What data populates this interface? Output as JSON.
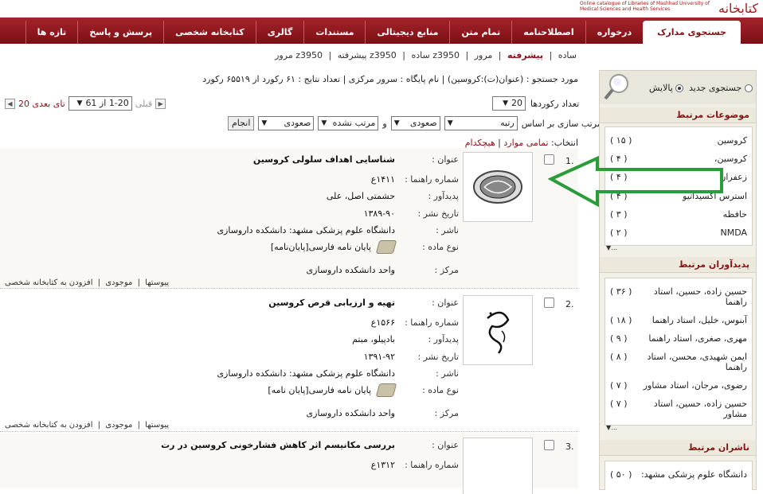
{
  "header": {
    "logo_text": "Online catalogue of Libraries of Mashhad University of Medical Sciences and Health Services",
    "logo_mark": "كتابخانه"
  },
  "nav": [
    {
      "label": "جستجوی مدارک",
      "active": true
    },
    {
      "label": "درخواره"
    },
    {
      "label": "اصطلاحنامه"
    },
    {
      "label": "تمام متن"
    },
    {
      "label": "منابع دیجیتالی"
    },
    {
      "label": "مستندات"
    },
    {
      "label": "گالری"
    },
    {
      "label": "کتابخانه شخصی"
    },
    {
      "label": "پرسش و پاسخ"
    },
    {
      "label": "تازه ها"
    }
  ],
  "breadcrumb": [
    "ساده",
    "|",
    "پیشرفته",
    "|",
    "مرور",
    "|",
    "z3950 ساده",
    "|",
    "z3950 پیشرفته",
    "|",
    "z3950 مرور"
  ],
  "summary": "مورد جستجو : (عنوان(ت):کروسین)  |  نام پایگاه : سرور مرکزی  |  تعداد نتایج : ۶۱ رکورد از ۶۵۵۱۹ رکورد",
  "pager": {
    "next_label": "20 تای بعدی",
    "range_value": "1-20 از 61",
    "prev_label": "قبلی"
  },
  "records": {
    "label": "تعداد رکوردها",
    "value": "20"
  },
  "sort": {
    "label": "مرتب سازی بر اساس",
    "field1": "رتبه",
    "order1": "صعودی",
    "and_label": "و",
    "field2": "مرتب نشده",
    "order2": "صعودی",
    "go": "انجام"
  },
  "select_bar": {
    "label": "انتخاب:",
    "all": "تمامی موارد",
    "sep": "|",
    "none": "هیچکدام"
  },
  "results": [
    {
      "num": "1.",
      "fields": [
        {
          "label": "عنوان :",
          "value": "شناسایی اهداف سلولی کروسین",
          "title": true
        },
        {
          "label": "شماره راهنما :",
          "value": "۱۴۱۱ع"
        },
        {
          "label": "پدیدآور :",
          "value": "حشمتی اصل، علی"
        },
        {
          "label": "تاریخ نشر :",
          "value": "۱۳۸۹-۹۰"
        },
        {
          "label": "ناشر :",
          "value": "دانشگاه علوم پزشکی مشهد: دانشکده داروسازی"
        },
        {
          "label": "نوع ماده :",
          "value": "پایان نامه فارسی[پایان‌نامه]"
        },
        {
          "label": "مرکز :",
          "value": "واحد دانشکده داروسازی"
        }
      ],
      "links": [
        "افزودن به کتابخانه شخصی",
        "|",
        "موجودی",
        "|",
        "پیوستها"
      ]
    },
    {
      "num": "2.",
      "fields": [
        {
          "label": "عنوان :",
          "value": "تهیه و ارزیابی قرص کروسین",
          "title": true
        },
        {
          "label": "شماره راهنما :",
          "value": "۱۵۶۶ع"
        },
        {
          "label": "پدیدآور :",
          "value": "بادپیلو، مبتم"
        },
        {
          "label": "تاریخ نشر :",
          "value": "۱۳۹۱-۹۲"
        },
        {
          "label": "ناشر :",
          "value": "دانشگاه علوم پزشکی مشهد: دانشکده داروسازی"
        },
        {
          "label": "نوع ماده :",
          "value": "پایان نامه فارسی[پایان نامه]"
        },
        {
          "label": "مرکز :",
          "value": "واحد دانشکده داروسازی"
        }
      ],
      "links": [
        "افزودن به کتابخانه شخصی",
        "|",
        "موجودی",
        "|",
        "پیوستها"
      ]
    },
    {
      "num": "3.",
      "fields": [
        {
          "label": "عنوان :",
          "value": "بررسی مکانیسم اثر کاهش فشارخونی کروسین در رت",
          "title": true
        },
        {
          "label": "شماره راهنما :",
          "value": "۱۳۱۲ع"
        }
      ]
    }
  ],
  "sidebar": {
    "new_search": "جستجوی جدید",
    "refine": "پالایش",
    "topics_title": "موضوعات مرتبط",
    "topics": [
      {
        "label": "کروسین",
        "count": "( ۱۵ )"
      },
      {
        "label": "کروسین،",
        "count": "( ۴ )"
      },
      {
        "label": "زعفران",
        "count": "( ۴ )"
      },
      {
        "label": "استرس اکسیداتیو",
        "count": "( ۴ )"
      },
      {
        "label": "حافظه",
        "count": "( ۳ )"
      },
      {
        "label": "NMDA",
        "count": "( ۲ )"
      }
    ],
    "authors_title": "پدیدآوران مرتبط",
    "authors": [
      {
        "label": "حسین زاده، حسین، استاد راهنما",
        "count": "( ۳۶ )"
      },
      {
        "label": "آبنوس، خلیل، استاد راهنما",
        "count": "( ۱۸ )"
      },
      {
        "label": "مهری، صغری، استاد راهنما",
        "count": "( ۹ )"
      },
      {
        "label": "ایمن شهیدی، محسن، استاد راهنما",
        "count": "( ۸ )"
      },
      {
        "label": "رضوی، مرجان، استاد مشاور",
        "count": "( ۷ )"
      },
      {
        "label": "حسین زاده، حسین، استاد مشاور",
        "count": "( ۷ )"
      }
    ],
    "publishers_title": "ناشران مرتبط",
    "publishers": [
      {
        "label": "دانشگاه علوم پزشکی مشهد:",
        "count": "( ۵۰ )"
      }
    ]
  },
  "colors": {
    "brand": "#8a1116",
    "nav_bg": "#a4242a",
    "arrow": "#2a9d3a"
  }
}
